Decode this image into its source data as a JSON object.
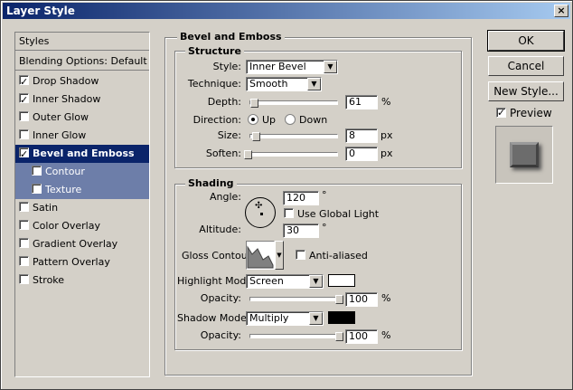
{
  "window": {
    "title": "Layer Style",
    "close_glyph": "×"
  },
  "styles_list": {
    "header": "Styles",
    "blending": "Blending Options: Default",
    "items": [
      {
        "label": "Drop Shadow",
        "checked": true
      },
      {
        "label": "Inner Shadow",
        "checked": true
      },
      {
        "label": "Outer Glow",
        "checked": false
      },
      {
        "label": "Inner Glow",
        "checked": false
      },
      {
        "label": "Bevel and Emboss",
        "checked": true,
        "selected": true
      },
      {
        "label": "Contour",
        "checked": false,
        "sub": true
      },
      {
        "label": "Texture",
        "checked": false,
        "sub": true
      },
      {
        "label": "Satin",
        "checked": false
      },
      {
        "label": "Color Overlay",
        "checked": false
      },
      {
        "label": "Gradient Overlay",
        "checked": false
      },
      {
        "label": "Pattern Overlay",
        "checked": false
      },
      {
        "label": "Stroke",
        "checked": false
      }
    ]
  },
  "bevel": {
    "title": "Bevel and Emboss",
    "structure": {
      "title": "Structure",
      "style_label": "Style:",
      "style_value": "Inner Bevel",
      "technique_label": "Technique:",
      "technique_value": "Smooth",
      "depth_label": "Depth:",
      "depth_value": "61",
      "depth_unit": "%",
      "direction_label": "Direction:",
      "dir_up": "Up",
      "dir_down": "Down",
      "size_label": "Size:",
      "size_value": "8",
      "size_unit": "px",
      "soften_label": "Soften:",
      "soften_value": "0",
      "soften_unit": "px"
    },
    "shading": {
      "title": "Shading",
      "angle_label": "Angle:",
      "angle_value": "120",
      "deg": "°",
      "global_light": "Use Global Light",
      "altitude_label": "Altitude:",
      "altitude_value": "30",
      "gloss_label": "Gloss Contour:",
      "anti_aliased": "Anti-aliased",
      "highlight_label": "Highlight Mode:",
      "highlight_value": "Screen",
      "highlight_color": "#ffffff",
      "opacity_label": "Opacity:",
      "highlight_opacity": "100",
      "pct": "%",
      "shadow_label": "Shadow Mode:",
      "shadow_value": "Multiply",
      "shadow_color": "#000000",
      "shadow_opacity": "100"
    }
  },
  "buttons": {
    "ok": "OK",
    "cancel": "Cancel",
    "new_style": "New Style...",
    "preview": "Preview"
  }
}
